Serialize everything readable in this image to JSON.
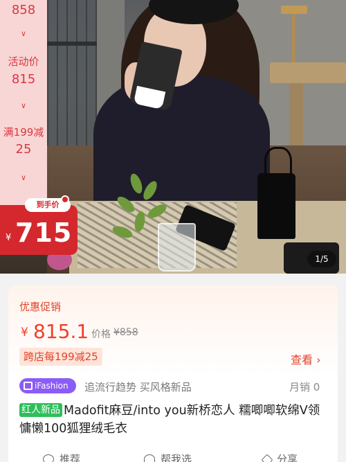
{
  "price_rail": {
    "step1_price": "858",
    "step2_label": "活动价",
    "step2_price": "815",
    "step3_label": "满199减",
    "step3_price": "25",
    "arrow": "∨"
  },
  "final_badge": {
    "tag": "到手价",
    "currency": "¥",
    "price": "715"
  },
  "pager": "1/5",
  "promo": {
    "title": "优惠促销",
    "currency": "¥",
    "current_price": "815.1",
    "orig_label": "价格",
    "orig_price": "¥858",
    "coupon": "跨店每199减25",
    "view_more": "查看 ›"
  },
  "brand": {
    "badge": "iFashion",
    "slogan": "追流行趋势 买风格新品",
    "sales": "月销 0"
  },
  "product": {
    "tag": "红人新品",
    "title": "Madofit麻豆/into you新桥恋人 糯唧唧软绵V领慵懒100狐狸绒毛衣"
  },
  "actions": {
    "recommend": "推荐",
    "help_choose": "帮我选",
    "share": "分享"
  },
  "colors": {
    "accent": "#f23d2a",
    "badge_red": "#d4282e",
    "brand_purple": "#8b5cf6",
    "new_green": "#2fbf5a"
  }
}
